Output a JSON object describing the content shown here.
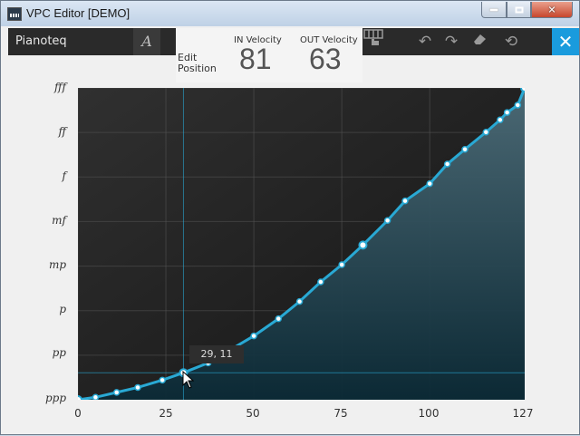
{
  "window": {
    "title": "VPC Editor [DEMO]"
  },
  "toolbar": {
    "preset_name": "Pianoteq",
    "edit_position_label": "Edit\nPosition",
    "in_velocity_label": "IN Velocity",
    "in_velocity_value": "81",
    "out_velocity_label": "OUT Velocity",
    "out_velocity_value": "63"
  },
  "colors": {
    "accent": "#1a9bdd",
    "curve": "#29a9d4",
    "plot_bg": "#1b1b1b"
  },
  "tooltip": {
    "text": "29, 11"
  },
  "chart_data": {
    "type": "line",
    "x_ticks": [
      "0",
      "25",
      "50",
      "75",
      "100",
      "127"
    ],
    "x_tick_values": [
      0,
      25,
      50,
      75,
      100,
      127
    ],
    "y_ticks": [
      "ppp",
      "pp",
      "p",
      "mp",
      "mf",
      "f",
      "ff",
      "fff"
    ],
    "xlim": [
      0,
      127
    ],
    "ylim": [
      0,
      127
    ],
    "grid": true,
    "series": [
      {
        "values": [
          [
            0,
            0
          ],
          [
            5,
            1
          ],
          [
            11,
            3
          ],
          [
            17,
            5
          ],
          [
            24,
            8
          ],
          [
            30,
            11
          ],
          [
            37,
            15
          ],
          [
            50,
            26
          ],
          [
            57,
            33
          ],
          [
            63,
            40
          ],
          [
            69,
            48
          ],
          [
            75,
            55
          ],
          [
            81,
            63
          ],
          [
            88,
            73
          ],
          [
            93,
            81
          ],
          [
            100,
            88
          ],
          [
            105,
            96
          ],
          [
            110,
            102
          ],
          [
            116,
            109
          ],
          [
            120,
            114
          ],
          [
            122,
            117
          ],
          [
            125,
            120
          ],
          [
            127,
            127
          ]
        ]
      }
    ],
    "edit_point": [
      81,
      63
    ],
    "selected_point": [
      30,
      11
    ]
  }
}
